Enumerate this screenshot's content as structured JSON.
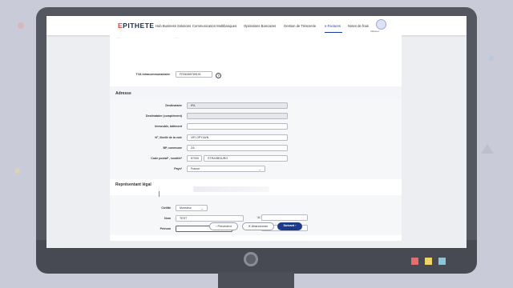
{
  "nav": {
    "logo_first_letter": "E",
    "logo_rest": "PITHETE",
    "menu": [
      "Hub Business Solutions",
      "Communication Multibanques",
      "Opérations Bancaires",
      "Gestion de Trésorerie",
      "e-Factures",
      "Notes de frais"
    ],
    "active_menu_index": 4,
    "user_label": "Utilisateur"
  },
  "tva": {
    "label": "TVA intracommunautaire",
    "value": "FR36389789191",
    "help": "?"
  },
  "adresse": {
    "title": "Adresse",
    "fields": {
      "destinataire": {
        "label": "Destinataire",
        "value": "IFA"
      },
      "complement": {
        "label": "Destinataire (complément)",
        "value": ""
      },
      "immeuble": {
        "label": "Immeuble, bâtiment",
        "value": ""
      },
      "voie": {
        "label": "N°, libellé de la voie",
        "value": "VIR OPYLWN"
      },
      "bp": {
        "label": "BP, commune",
        "value": "ZA"
      },
      "code_postal": {
        "label": "Code postal* , localité*",
        "value": "67000"
      },
      "localite": {
        "value": "STRASBOURG"
      },
      "pays": {
        "label": "Pays*",
        "value": "France"
      }
    }
  },
  "representant": {
    "title": "Représentant légal",
    "civilite": {
      "label": "Civilité",
      "value": "Monsieur"
    },
    "nom": {
      "label": "Nom",
      "value": "TEST"
    },
    "prenom": {
      "label": "Prénom",
      "value": ""
    },
    "phone_value": "",
    "email_value": ""
  },
  "buttons": {
    "previous": "‹ Précédent",
    "cancel": "✕ Abandonner",
    "next": "Suivant ›"
  },
  "colors": {
    "accent": "#1d3a8a",
    "logo_accent": "#e13d3d",
    "monitor": "#54575f"
  }
}
